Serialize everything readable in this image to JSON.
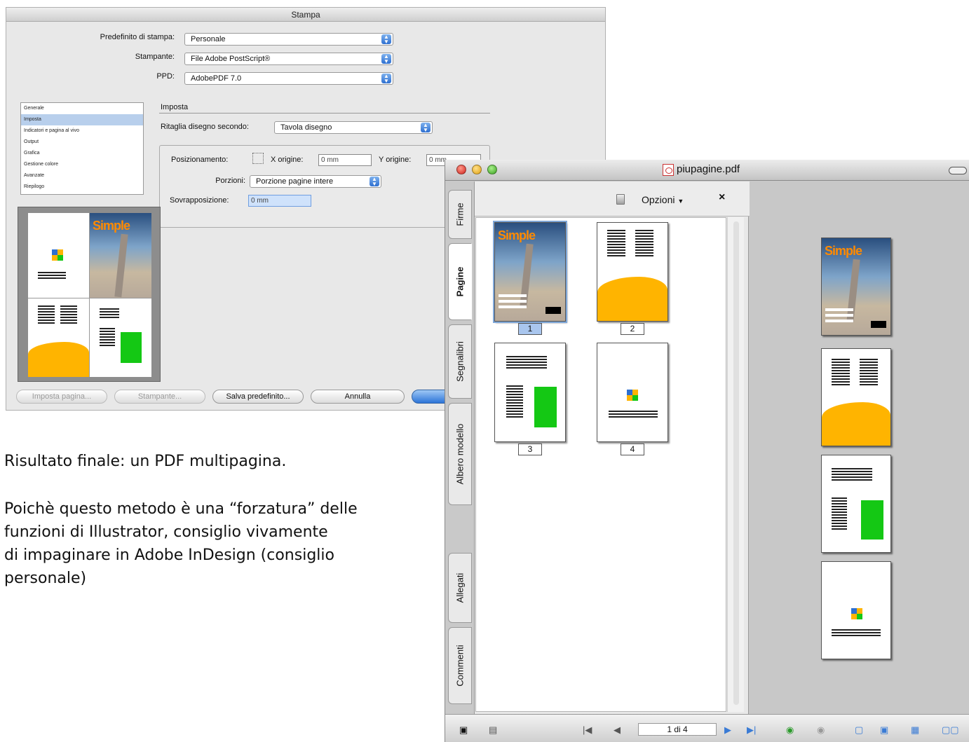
{
  "print_dialog": {
    "title": "Stampa",
    "preset_label": "Predefinito di stampa:",
    "preset_value": "Personale",
    "printer_label": "Stampante:",
    "printer_value": "File Adobe PostScript®",
    "ppd_label": "PPD:",
    "ppd_value": "AdobePDF 7.0",
    "categories": [
      "Generale",
      "Imposta",
      "Indicatori e pagina al vivo",
      "Output",
      "Grafica",
      "Gestione colore",
      "Avanzate",
      "Riepilogo"
    ],
    "selected_category": "Imposta",
    "section_title": "Imposta",
    "crop_label": "Ritaglia disegno secondo:",
    "crop_value": "Tavola disegno",
    "position_label": "Posizionamento:",
    "x_origin_label": "X origine:",
    "x_origin_value": "0 mm",
    "y_origin_label": "Y origine:",
    "y_origin_value": "0 mm",
    "tiling_label": "Porzioni:",
    "tiling_value": "Porzione pagine intere",
    "overlap_label": "Sovrapposizione:",
    "overlap_value": "0 mm",
    "buttons": {
      "page_setup": "Imposta pagina...",
      "printer": "Stampante...",
      "save_preset": "Salva predefinito...",
      "cancel": "Annulla"
    },
    "preview_logo": "Simple"
  },
  "caption": {
    "line1": "Risultato finale: un PDF multipagina.",
    "para_lines": [
      "Poichè questo metodo è una “forzatura” delle",
      "funzioni di Illustrator, consiglio vivamente",
      "di impaginare in Adobe InDesign (consiglio",
      "personale)"
    ]
  },
  "acrobat": {
    "window_title": "piupagine.pdf",
    "tabs": [
      "Firme",
      "Pagine",
      "Segnalibri",
      "Albero modello",
      "Allegati",
      "Commenti"
    ],
    "active_tab": "Pagine",
    "panel_options": "Opzioni",
    "close_symbol": "×",
    "page_numbers": [
      "1",
      "2",
      "3",
      "4"
    ],
    "selected_page": "1",
    "page_indicator": "1 di 4",
    "cover_logo": "Simple",
    "colors": {
      "orange": "#ffb400",
      "green": "#14c814",
      "blue_accent": "#2d6fd0"
    }
  }
}
